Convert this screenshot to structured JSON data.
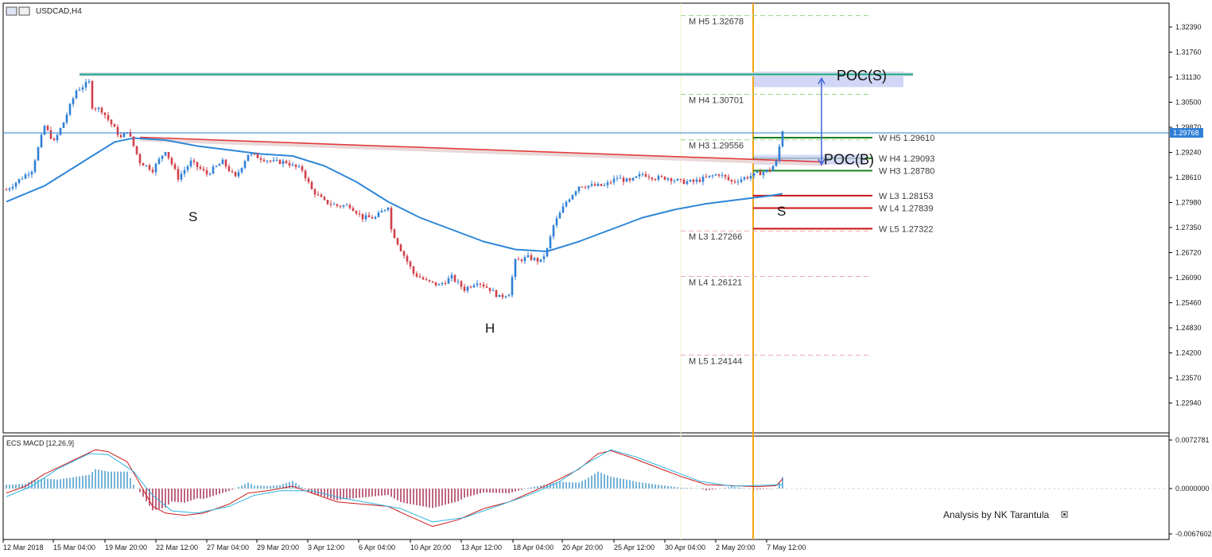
{
  "symbol": "USDCAD,H4",
  "macd_title": "ECS MACD [12,26,9]",
  "credit": "Analysis by NK Tarantula",
  "price_scale": [
    "1.32390",
    "1.31760",
    "1.31130",
    "1.30500",
    "1.29870",
    "1.29240",
    "1.28610",
    "1.27980",
    "1.27350",
    "1.26720",
    "1.26090",
    "1.25460",
    "1.24830",
    "1.24200",
    "1.23570",
    "1.22940"
  ],
  "macd_scale": [
    "0.0072781",
    "0.0000000",
    "-0.0067602"
  ],
  "current_price": "1.29768",
  "x_labels": [
    "12 Mar 2018",
    "15 Mar 04:00",
    "19 Mar 20:00",
    "22 Mar 12:00",
    "27 Mar 04:00",
    "29 Mar 20:00",
    "3 Apr 12:00",
    "6 Apr 04:00",
    "10 Apr 20:00",
    "13 Apr 12:00",
    "18 Apr 04:00",
    "20 Apr 20:00",
    "25 Apr 12:00",
    "30 Apr 04:00",
    "2 May 20:00",
    "7 May 12:00"
  ],
  "monthly_levels": [
    {
      "label": "M  H5 1.32678",
      "value": 1.32678,
      "color": "#9bd08a"
    },
    {
      "label": "M  H4 1.30701",
      "value": 1.30701,
      "color": "#9bd08a"
    },
    {
      "label": "M  H3 1.29556",
      "value": 1.29556,
      "color": "#9bd08a"
    },
    {
      "label": "M  L3 1.27266",
      "value": 1.27266,
      "color": "#f0a8a8"
    },
    {
      "label": "M  L4 1.26121",
      "value": 1.26121,
      "color": "#f0a8a8"
    },
    {
      "label": "M  L5 1.24144",
      "value": 1.24144,
      "color": "#f0a8a8"
    }
  ],
  "weekly_levels": [
    {
      "label": "W  H5 1.29610",
      "value": 1.2961,
      "color": "#1a7f1a"
    },
    {
      "label": "W  H4 1.29093",
      "value": 1.29093,
      "color": "#1a7f1a"
    },
    {
      "label": "W  H3 1.28780",
      "value": 1.2878,
      "color": "#1a7f1a"
    },
    {
      "label": "W  L3 1.28153",
      "value": 1.28153,
      "color": "#cc1111"
    },
    {
      "label": "W  L4 1.27839",
      "value": 1.27839,
      "color": "#cc1111"
    },
    {
      "label": "W  L5 1.27322",
      "value": 1.27322,
      "color": "#cc1111"
    }
  ],
  "annotations": {
    "poc_s": "POC(S)",
    "poc_b": "POC(B)",
    "left_shoulder": "S",
    "head": "H",
    "right_shoulder": "S"
  },
  "colors": {
    "bull": "#2f7fd6",
    "bear": "#d2404a",
    "ma": "#2f86d8",
    "neckline": "#e03a3a",
    "resistance": "#1aa58a",
    "vertical": "#f2a51a",
    "macd_line": "#cc1a1a",
    "signal_line": "#2fb3e0",
    "hist_pos": "#3a92c8",
    "hist_neg": "#a3244a"
  },
  "chart_data": {
    "type": "candlestick",
    "symbol": "USDCAD",
    "timeframe": "H4",
    "ylim": [
      1.2255,
      1.329
    ],
    "close_path": [
      [
        0,
        1.283
      ],
      [
        8,
        1.288
      ],
      [
        12,
        1.299
      ],
      [
        15,
        1.295
      ],
      [
        18,
        1.3
      ],
      [
        22,
        1.308
      ],
      [
        26,
        1.31
      ],
      [
        27,
        1.304
      ],
      [
        30,
        1.303
      ],
      [
        36,
        1.296
      ],
      [
        38,
        1.298
      ],
      [
        42,
        1.29
      ],
      [
        46,
        1.288
      ],
      [
        50,
        1.293
      ],
      [
        54,
        1.286
      ],
      [
        58,
        1.29
      ],
      [
        63,
        1.287
      ],
      [
        68,
        1.29
      ],
      [
        72,
        1.286
      ],
      [
        76,
        1.292
      ],
      [
        80,
        1.291
      ],
      [
        84,
        1.29
      ],
      [
        88,
        1.29
      ],
      [
        90,
        1.289
      ],
      [
        93,
        1.288
      ],
      [
        96,
        1.283
      ],
      [
        100,
        1.28
      ],
      [
        104,
        1.279
      ],
      [
        108,
        1.279
      ],
      [
        112,
        1.276
      ],
      [
        116,
        1.276
      ],
      [
        120,
        1.279
      ],
      [
        121,
        1.273
      ],
      [
        124,
        1.268
      ],
      [
        128,
        1.262
      ],
      [
        132,
        1.26
      ],
      [
        136,
        1.259
      ],
      [
        140,
        1.261
      ],
      [
        144,
        1.258
      ],
      [
        148,
        1.26
      ],
      [
        152,
        1.258
      ],
      [
        155,
        1.256
      ],
      [
        158,
        1.257
      ],
      [
        160,
        1.265
      ],
      [
        164,
        1.266
      ],
      [
        168,
        1.265
      ],
      [
        170,
        1.268
      ],
      [
        172,
        1.274
      ],
      [
        176,
        1.28
      ],
      [
        180,
        1.284
      ],
      [
        184,
        1.284
      ],
      [
        188,
        1.284
      ],
      [
        192,
        1.286
      ],
      [
        196,
        1.285
      ],
      [
        200,
        1.287
      ],
      [
        204,
        1.286
      ],
      [
        208,
        1.286
      ],
      [
        212,
        1.285
      ],
      [
        216,
        1.285
      ],
      [
        220,
        1.286
      ],
      [
        224,
        1.287
      ],
      [
        228,
        1.285
      ],
      [
        232,
        1.286
      ],
      [
        236,
        1.287
      ],
      [
        240,
        1.288
      ],
      [
        242,
        1.29
      ],
      [
        244,
        1.2977
      ]
    ],
    "ma_path": [
      [
        0,
        1.28
      ],
      [
        12,
        1.284
      ],
      [
        24,
        1.29
      ],
      [
        34,
        1.295
      ],
      [
        40,
        1.296
      ],
      [
        50,
        1.2955
      ],
      [
        60,
        1.294
      ],
      [
        70,
        1.293
      ],
      [
        80,
        1.292
      ],
      [
        90,
        1.2915
      ],
      [
        100,
        1.289
      ],
      [
        110,
        1.285
      ],
      [
        120,
        1.28
      ],
      [
        130,
        1.276
      ],
      [
        140,
        1.273
      ],
      [
        150,
        1.27
      ],
      [
        160,
        1.268
      ],
      [
        170,
        1.2675
      ],
      [
        180,
        1.27
      ],
      [
        190,
        1.273
      ],
      [
        200,
        1.276
      ],
      [
        210,
        1.278
      ],
      [
        220,
        1.2795
      ],
      [
        230,
        1.2805
      ],
      [
        240,
        1.2815
      ],
      [
        244,
        1.282
      ]
    ],
    "levels": {
      "neckline": [
        [
          1.2962,
          1.29
        ]
      ],
      "resistance": 1.312
    }
  }
}
